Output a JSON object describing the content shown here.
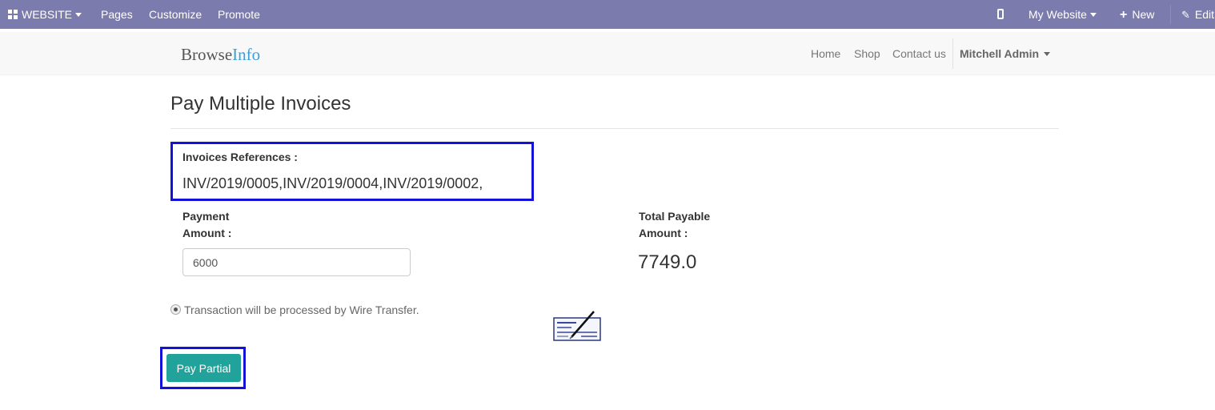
{
  "admin_bar": {
    "website_label": "WEBSITE",
    "pages_label": "Pages",
    "customize_label": "Customize",
    "promote_label": "Promote",
    "my_website_label": "My Website",
    "new_label": "New",
    "edit_label": "Edit"
  },
  "header": {
    "brand_part1": "Browse",
    "brand_part2": "Info",
    "nav": [
      "Home",
      "Shop",
      "Contact us"
    ],
    "user_name": "Mitchell Admin"
  },
  "page": {
    "title": "Pay Multiple Invoices",
    "invoice_refs_label": "Invoices References :",
    "invoice_refs_value": "INV/2019/0005,INV/2019/0004,INV/2019/0002,",
    "payment_amount_label_line1": "Payment",
    "payment_amount_label_line2": "Amount :",
    "payment_amount_value": "6000",
    "total_payable_label_line1": "Total Payable",
    "total_payable_label_line2": "Amount :",
    "total_payable_value": "7749.0",
    "payment_method_text": "Transaction will be processed by Wire Transfer.",
    "pay_button_label": "Pay Partial"
  },
  "colors": {
    "admin_bar": "#7c7bad",
    "brand_accent": "#3aa0d8",
    "pay_button": "#21a39b",
    "highlight_border": "#1212d8"
  },
  "icons": [
    "apps-grid-icon",
    "mobile-preview-icon",
    "plus-icon",
    "pencil-icon",
    "cheque-icon"
  ]
}
